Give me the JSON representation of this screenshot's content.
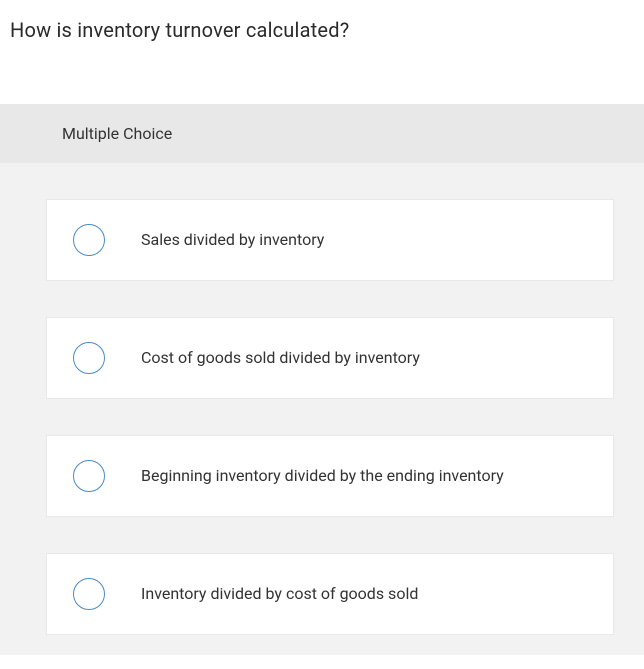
{
  "question": "How is inventory turnover calculated?",
  "section_label": "Multiple Choice",
  "options": [
    {
      "text": "Sales divided by inventory"
    },
    {
      "text": "Cost of goods sold divided by inventory"
    },
    {
      "text": "Beginning inventory divided by the ending inventory"
    },
    {
      "text": "Inventory divided by cost of goods sold"
    }
  ]
}
